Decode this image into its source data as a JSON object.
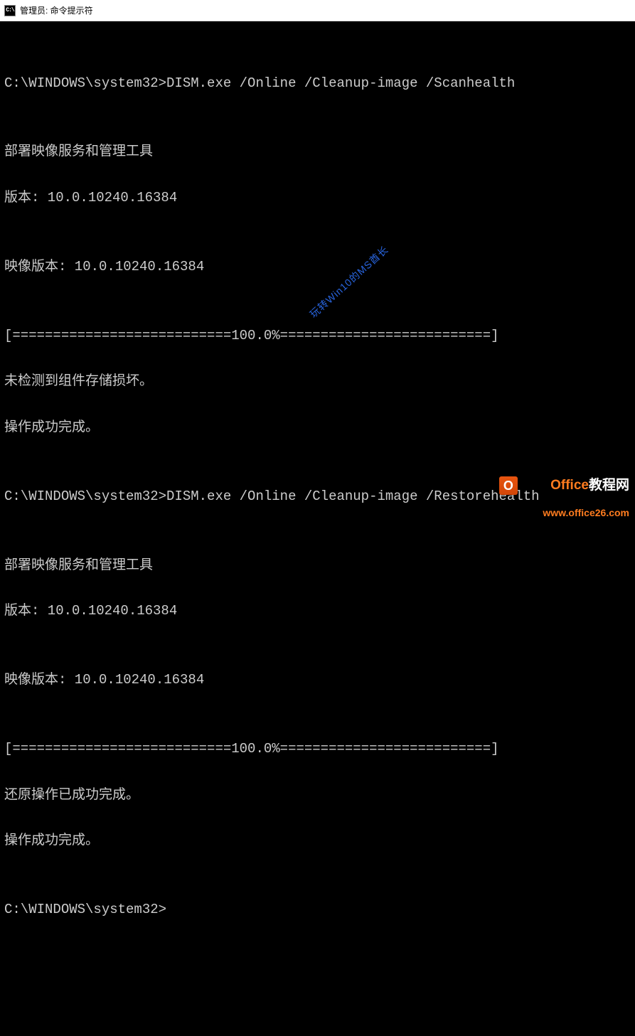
{
  "titlebar": {
    "icon_label": "C:\\",
    "text": "管理员: 命令提示符"
  },
  "terminal": {
    "lines": [
      "",
      "C:\\WINDOWS\\system32>DISM.exe /Online /Cleanup-image /Scanhealth",
      "",
      "部署映像服务和管理工具",
      "版本: 10.0.10240.16384",
      "",
      "映像版本: 10.0.10240.16384",
      "",
      "[===========================100.0%==========================] ",
      "未检测到组件存储损坏。",
      "操作成功完成。",
      "",
      "C:\\WINDOWS\\system32>DISM.exe /Online /Cleanup-image /Restorehealth",
      "",
      "部署映像服务和管理工具",
      "版本: 10.0.10240.16384",
      "",
      "映像版本: 10.0.10240.16384",
      "",
      "[===========================100.0%==========================] ",
      "还原操作已成功完成。",
      "操作成功完成。",
      "",
      "C:\\WINDOWS\\system32>"
    ]
  },
  "watermark": {
    "text": "玩转Win10的MS酋长"
  },
  "logo": {
    "icon_letter": "O",
    "brand_prefix": "Office",
    "brand_suffix": "教程网",
    "url": "www.office26.com"
  }
}
